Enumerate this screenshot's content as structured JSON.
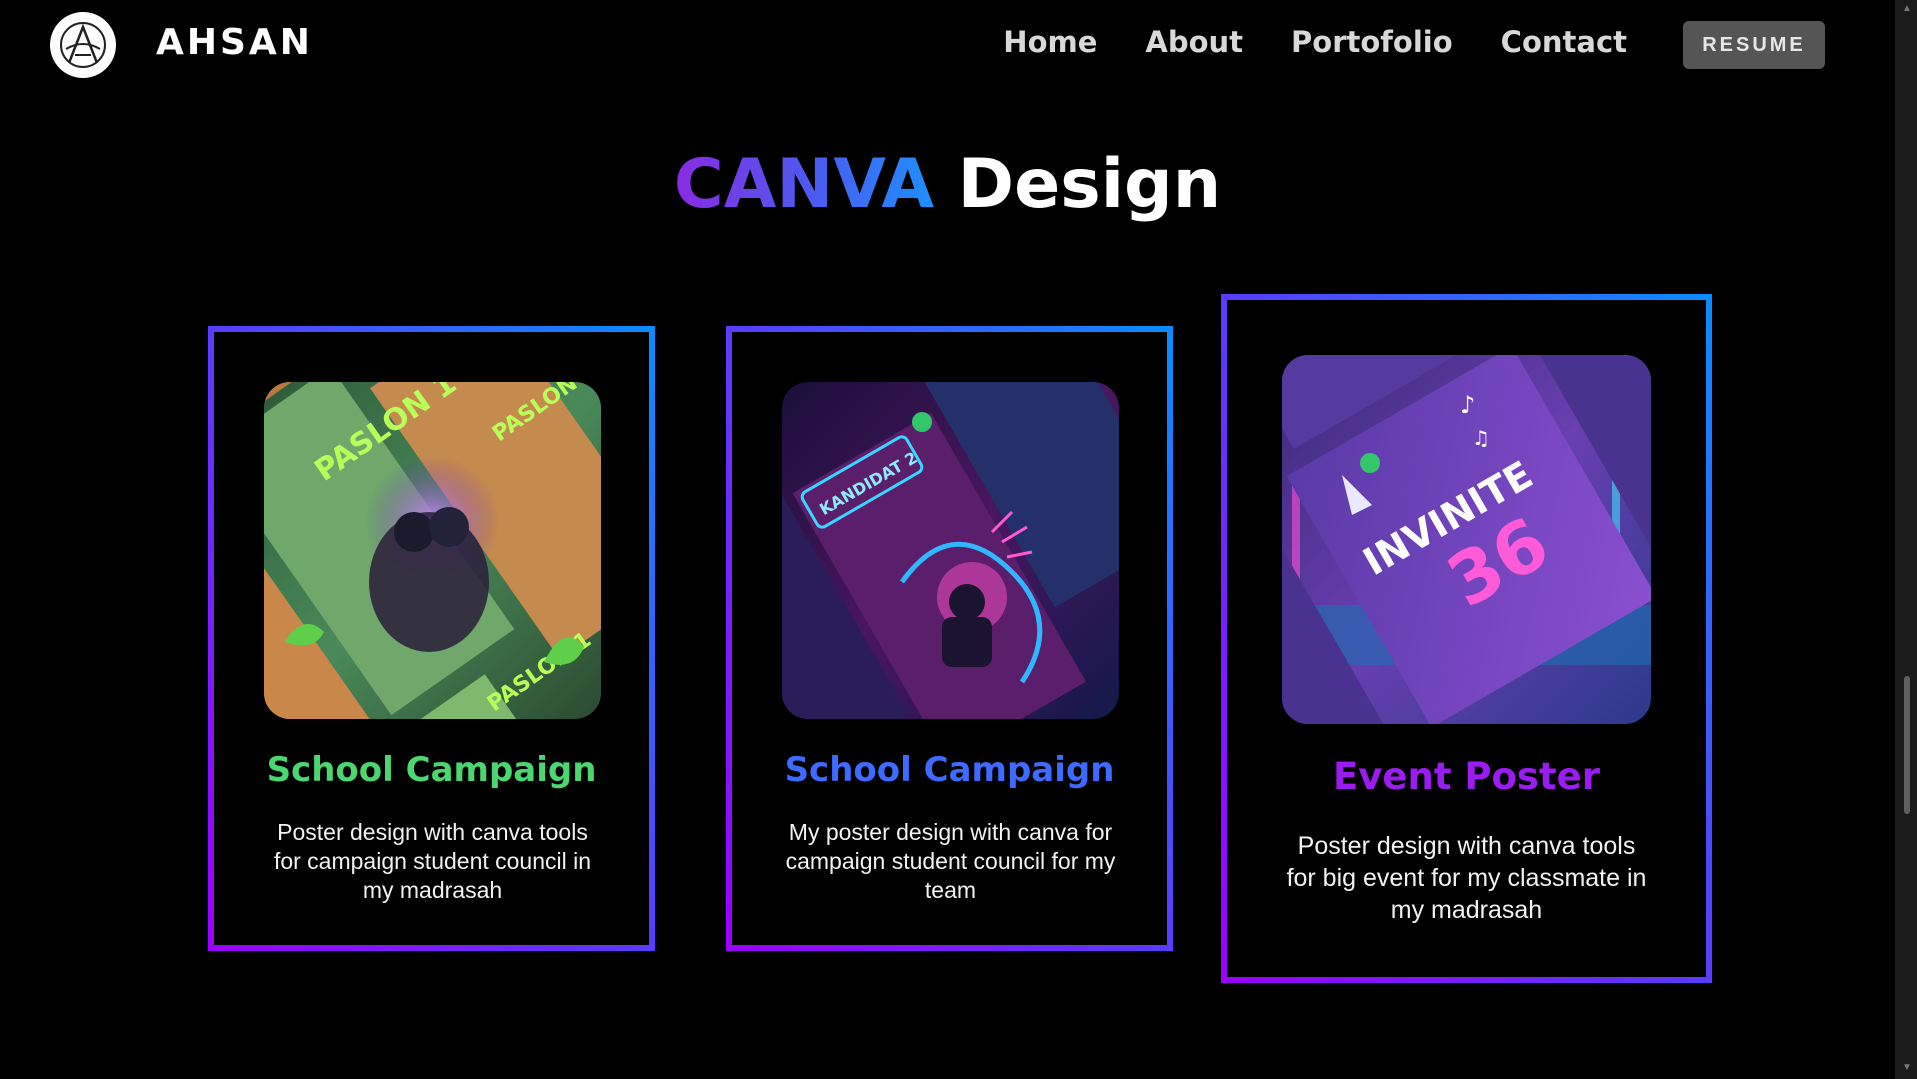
{
  "nav": {
    "brand": "AHSAN",
    "links": [
      "Home",
      "About",
      "Portofolio",
      "Contact"
    ],
    "resume_label": "RESUME"
  },
  "section": {
    "title_accent": "CANVA",
    "title_rest": "Design"
  },
  "cards": [
    {
      "title": "School Campaign",
      "title_color": "#4cd66f",
      "poster_text": "PASLON 1",
      "description": "Poster design with canva tools for campaign student council in my madrasah"
    },
    {
      "title": "School Campaign",
      "title_color": "#3d6bff",
      "poster_text": "KANDIDAT 2",
      "description": "My poster design with canva for campaign student council for my team"
    },
    {
      "title": "Event Poster",
      "title_color": "#9b1cf0",
      "poster_text": "INVINITE",
      "poster_number": "36",
      "description": "Poster design with canva tools for big event for my classmate in my madrasah"
    }
  ]
}
